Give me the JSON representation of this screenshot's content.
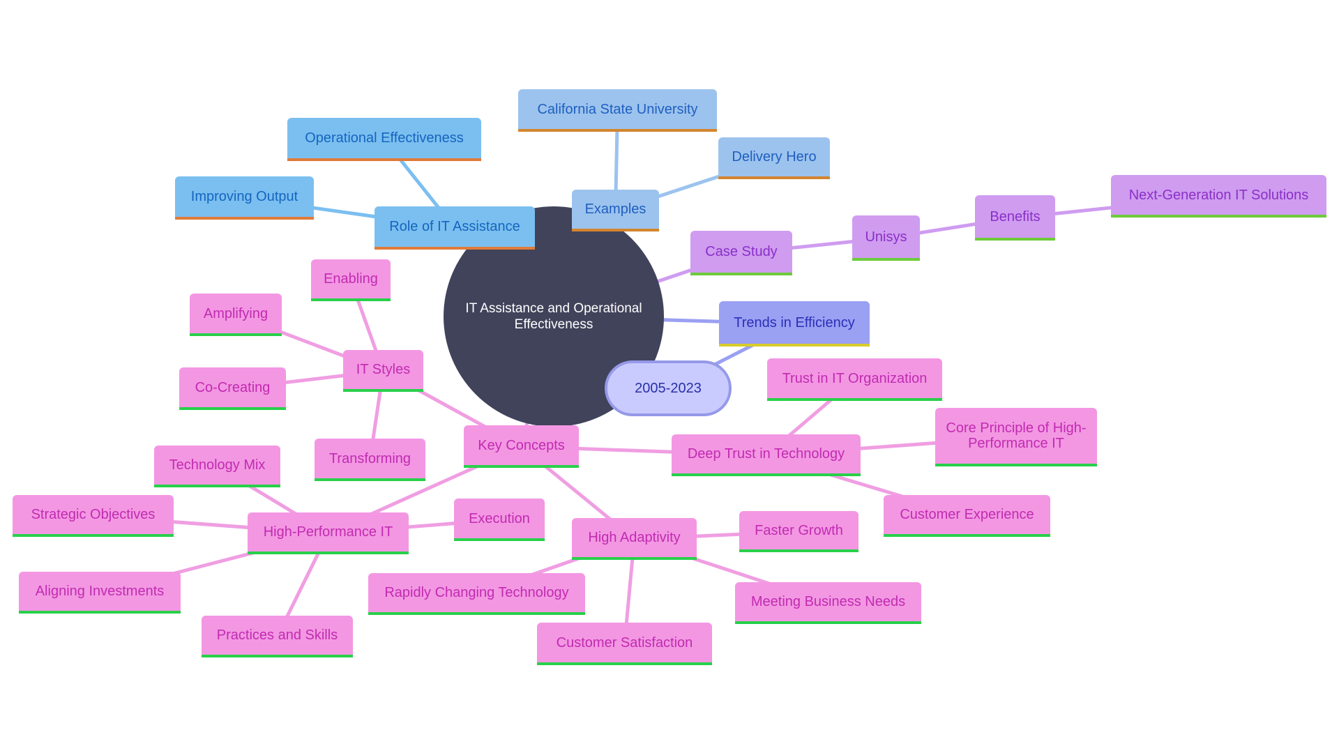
{
  "diagram": {
    "type": "mindmap",
    "root": "IT Assistance and Operational Effectiveness",
    "colors": {
      "root_fill": "#40435a",
      "blue_branch": "#7bbff0",
      "light_blue_branch": "#9cc3ee",
      "purple_branch": "#cf9cf0",
      "indigo_branch": "#9aa0f2",
      "pink_branch": "#f397e3",
      "orange_underline": "#e07b39",
      "green_underline": "#28d04a",
      "yellow_underline": "#d8cc2a"
    },
    "nodes": {
      "role": "Role of IT Assistance",
      "op_effectiveness": "Operational Effectiveness",
      "improving_output": "Improving Output",
      "examples": "Examples",
      "csu": "California State University",
      "delivery_hero": "Delivery Hero",
      "case_study": "Case Study",
      "unisys": "Unisys",
      "benefits": "Benefits",
      "next_gen": "Next-Generation IT Solutions",
      "trends": "Trends in Efficiency",
      "years": "2005-2023",
      "key_concepts": "Key Concepts",
      "it_styles": "IT Styles",
      "enabling": "Enabling",
      "amplifying": "Amplifying",
      "co_creating": "Co-Creating",
      "transforming": "Transforming",
      "hpit": "High-Performance IT",
      "tech_mix": "Technology Mix",
      "strategic": "Strategic Objectives",
      "aligning": "Aligning Investments",
      "practices": "Practices and Skills",
      "execution": "Execution",
      "high_adaptivity": "High Adaptivity",
      "faster_growth": "Faster Growth",
      "rapidly": "Rapidly Changing Technology",
      "cust_sat": "Customer Satisfaction",
      "meeting_needs": "Meeting Business Needs",
      "deep_trust": "Deep Trust in Technology",
      "trust_it_org": "Trust in IT Organization",
      "core_principle": "Core Principle of High-Performance IT",
      "cust_exp": "Customer Experience"
    },
    "edges": [
      [
        "root",
        "role"
      ],
      [
        "role",
        "op_effectiveness"
      ],
      [
        "role",
        "improving_output"
      ],
      [
        "root",
        "examples"
      ],
      [
        "examples",
        "csu"
      ],
      [
        "examples",
        "delivery_hero"
      ],
      [
        "root",
        "case_study"
      ],
      [
        "case_study",
        "unisys"
      ],
      [
        "unisys",
        "benefits"
      ],
      [
        "benefits",
        "next_gen"
      ],
      [
        "root",
        "trends"
      ],
      [
        "trends",
        "years"
      ],
      [
        "root",
        "key_concepts"
      ],
      [
        "key_concepts",
        "it_styles"
      ],
      [
        "it_styles",
        "enabling"
      ],
      [
        "it_styles",
        "amplifying"
      ],
      [
        "it_styles",
        "co_creating"
      ],
      [
        "it_styles",
        "transforming"
      ],
      [
        "key_concepts",
        "hpit"
      ],
      [
        "hpit",
        "tech_mix"
      ],
      [
        "hpit",
        "strategic"
      ],
      [
        "hpit",
        "aligning"
      ],
      [
        "hpit",
        "practices"
      ],
      [
        "hpit",
        "execution"
      ],
      [
        "key_concepts",
        "high_adaptivity"
      ],
      [
        "high_adaptivity",
        "faster_growth"
      ],
      [
        "high_adaptivity",
        "rapidly"
      ],
      [
        "high_adaptivity",
        "cust_sat"
      ],
      [
        "high_adaptivity",
        "meeting_needs"
      ],
      [
        "key_concepts",
        "deep_trust"
      ],
      [
        "deep_trust",
        "trust_it_org"
      ],
      [
        "deep_trust",
        "core_principle"
      ],
      [
        "deep_trust",
        "cust_exp"
      ]
    ]
  }
}
